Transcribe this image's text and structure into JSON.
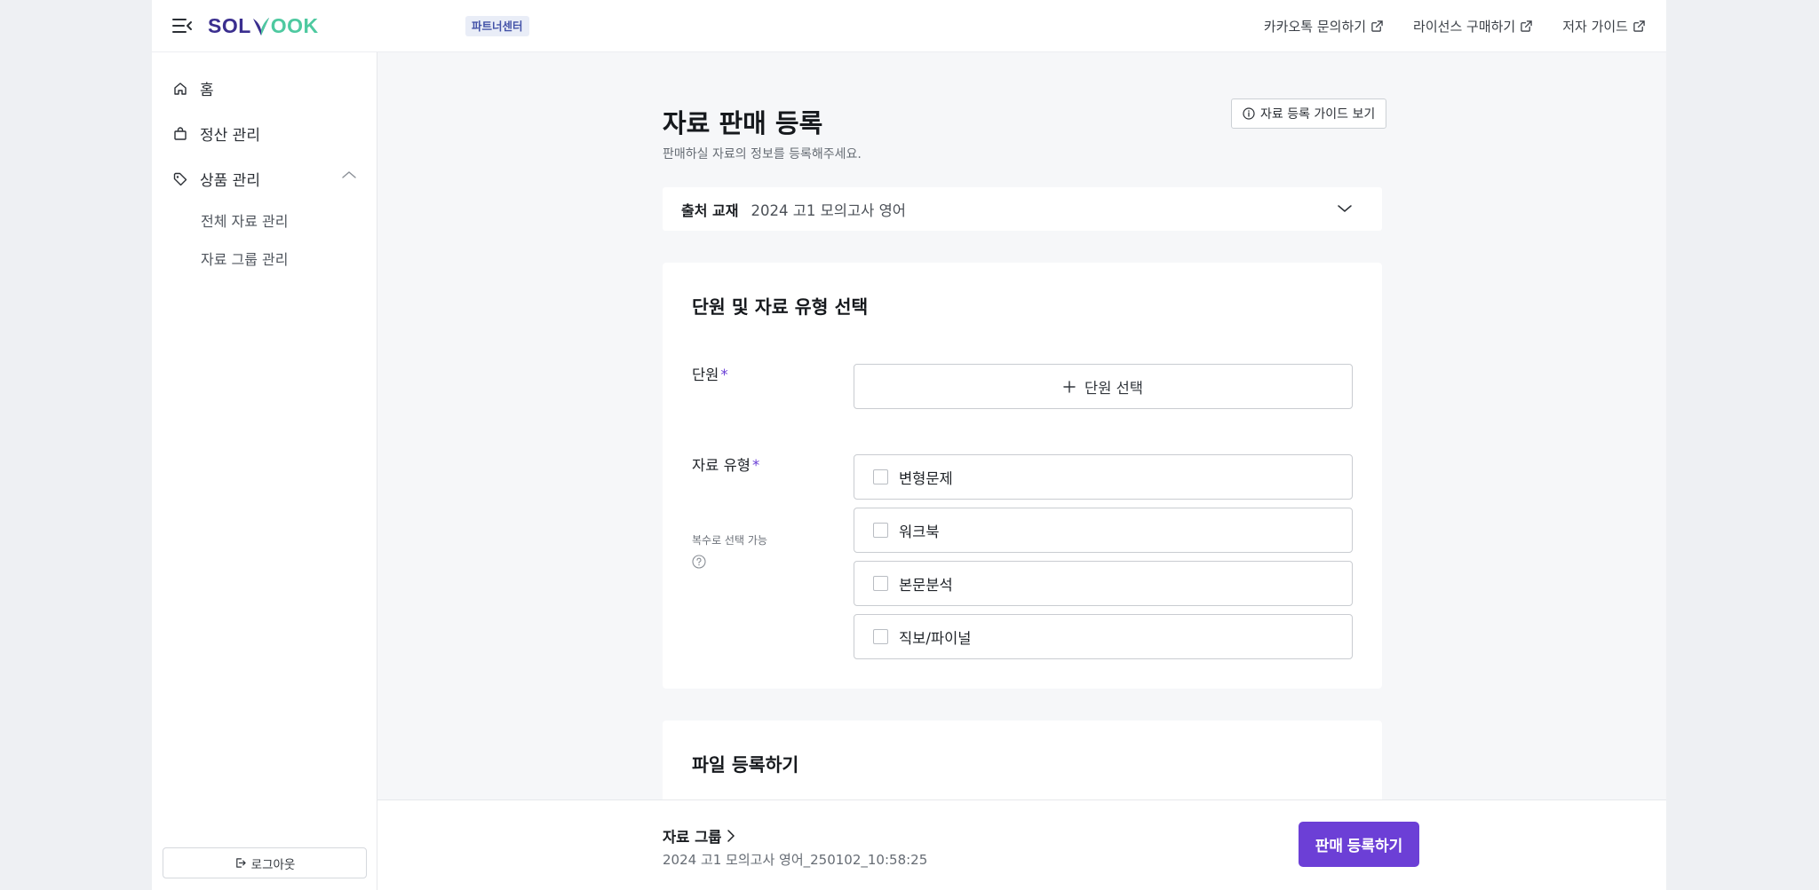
{
  "header": {
    "logo": {
      "part1": "SOL",
      "part2": "OOK"
    },
    "badge": "파트너센터",
    "links": [
      {
        "label": "카카오톡 문의하기"
      },
      {
        "label": "라이선스 구매하기"
      },
      {
        "label": "저자 가이드"
      }
    ]
  },
  "sidebar": {
    "items": [
      {
        "label": "홈",
        "icon": "home-icon"
      },
      {
        "label": "정산 관리",
        "icon": "bag-icon"
      },
      {
        "label": "상품 관리",
        "icon": "tag-icon",
        "expanded": true
      }
    ],
    "subitems": [
      {
        "label": "전체 자료 관리"
      },
      {
        "label": "자료 그룹 관리"
      }
    ],
    "logout": "로그아웃"
  },
  "main": {
    "title": "자료 판매 등록",
    "subtitle": "판매하실 자료의 정보를 등록해주세요.",
    "guide_button": "자료 등록 가이드 보기",
    "source": {
      "label": "출처 교재",
      "value": "2024 고1 모의고사 영어"
    },
    "unit_section": {
      "title": "단원 및 자료 유형 선택",
      "unit_label": "단원",
      "required_mark": "*",
      "unit_button": "단원 선택",
      "type_label": "자료 유형",
      "type_hint": "복수로 선택 가능",
      "types": [
        {
          "label": "변형문제",
          "checked": false
        },
        {
          "label": "워크북",
          "checked": false
        },
        {
          "label": "본문분석",
          "checked": false
        },
        {
          "label": "직보/파이널",
          "checked": false
        }
      ]
    },
    "file_section": {
      "title": "파일 등록하기"
    }
  },
  "bottom_bar": {
    "group_link": "자료 그룹",
    "group_name": "2024 고1 모의고사 영어_250102_10:58:25",
    "submit": "판매 등록하기"
  },
  "colors": {
    "accent": "#6c3fd6",
    "logo_primary": "#3b2f8f",
    "logo_secondary": "#4ec9a0",
    "badge_bg": "#e9edf7",
    "page_bg": "#f6f7f9"
  }
}
